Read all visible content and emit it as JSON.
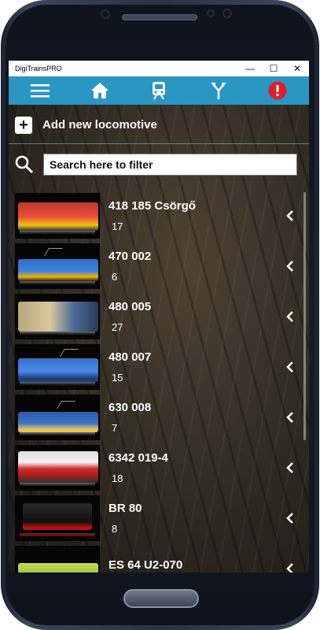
{
  "window": {
    "title": "DigiTrainsPRO"
  },
  "toolbar": {
    "icons": [
      "menu-icon",
      "home-icon",
      "train-icon",
      "switch-icon",
      "alert-icon"
    ],
    "accent": "#2a96c4",
    "alert_color": "#e11d2a"
  },
  "add": {
    "label": "Add new locomotive"
  },
  "search": {
    "placeholder": "Search here to filter"
  },
  "locomotives": [
    {
      "name": "418 185 Csörgő",
      "number": "17"
    },
    {
      "name": "470 002",
      "number": "6"
    },
    {
      "name": "480 005",
      "number": "27"
    },
    {
      "name": "480 007",
      "number": "15"
    },
    {
      "name": "630 008",
      "number": "7"
    },
    {
      "name": "6342 019-4",
      "number": "18"
    },
    {
      "name": "BR 80",
      "number": "8"
    },
    {
      "name": "ES 64 U2-070",
      "number": ""
    }
  ]
}
